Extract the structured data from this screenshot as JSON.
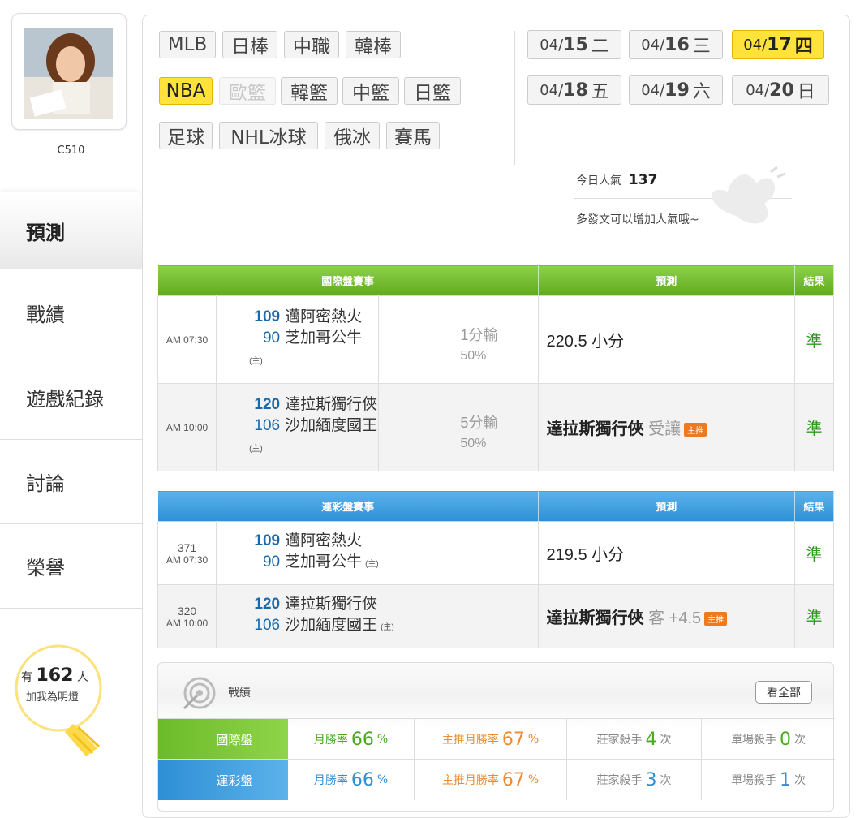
{
  "profile": {
    "name": "C510"
  },
  "nav": [
    {
      "label": "預測",
      "active": true
    },
    {
      "label": "戰績"
    },
    {
      "label": "遊戲紀錄"
    },
    {
      "label": "討論"
    },
    {
      "label": "榮譽"
    }
  ],
  "fans": {
    "prefix": "有",
    "count": "162",
    "suffix": "人",
    "line2": "加我為明燈"
  },
  "sports": {
    "row1": [
      "MLB",
      "日棒",
      "中職",
      "韓棒"
    ],
    "row2": [
      "NBA",
      "歐籃",
      "韓籃",
      "中籃",
      "日籃"
    ],
    "row3": [
      "足球",
      "NHL冰球",
      "俄冰",
      "賽馬"
    ],
    "selected": "NBA",
    "disabled": "歐籃"
  },
  "dates": [
    {
      "md": "04/",
      "d": "15",
      "w": "二"
    },
    {
      "md": "04/",
      "d": "16",
      "w": "三"
    },
    {
      "md": "04/",
      "d": "17",
      "w": "四",
      "selected": true
    },
    {
      "md": "04/",
      "d": "18",
      "w": "五"
    },
    {
      "md": "04/",
      "d": "19",
      "w": "六"
    },
    {
      "md": "04/",
      "d": "20",
      "w": "日"
    }
  ],
  "popularity": {
    "label": "今日人氣",
    "value": "137",
    "hint": "多發文可以增加人氣哦~"
  },
  "intl": {
    "headers": [
      "國際盤賽事",
      "預測",
      "結果"
    ],
    "rows": [
      {
        "time": "AM 07:30",
        "s1": "109",
        "t1": "邁阿密熱火",
        "s2": "90",
        "t2": "芝加哥公牛",
        "home": "(主)",
        "spread": "1分輸",
        "pct": "50%",
        "pred": "220.5 小分",
        "result": "準"
      },
      {
        "time": "AM 10:00",
        "s1": "120",
        "t1": "達拉斯獨行俠",
        "s2": "106",
        "t2": "沙加緬度國王",
        "home": "(主)",
        "spread": "5分輸",
        "pct": "50%",
        "pred": "達拉斯獨行俠",
        "pred_extra": "受讓",
        "badge": "主推",
        "result": "準"
      }
    ]
  },
  "lottery": {
    "headers": [
      "運彩盤賽事",
      "預測",
      "結果"
    ],
    "rows": [
      {
        "no": "371",
        "time": "AM 07:30",
        "s1": "109",
        "t1": "邁阿密熱火",
        "s2": "90",
        "t2": "芝加哥公牛",
        "home": "(主)",
        "pred": "219.5 小分",
        "result": "準"
      },
      {
        "no": "320",
        "time": "AM 10:00",
        "s1": "120",
        "t1": "達拉斯獨行俠",
        "s2": "106",
        "t2": "沙加緬度國王",
        "home": "(主)",
        "pred": "達拉斯獨行俠",
        "pred_extra": "客 +4.5",
        "badge": "主推",
        "result": "準"
      }
    ]
  },
  "record": {
    "title": "戰績",
    "view_all": "看全部",
    "rows": [
      {
        "label": "國際盤",
        "win_label": "月勝率",
        "win": "66",
        "main_label": "主推月勝率",
        "main": "67",
        "pct": "%",
        "dealer_label": "莊家殺手",
        "dealer": "4",
        "single_label": "單場殺手",
        "single": "0",
        "unit": "次"
      },
      {
        "label": "運彩盤",
        "win_label": "月勝率",
        "win": "66",
        "main_label": "主推月勝率",
        "main": "67",
        "pct": "%",
        "dealer_label": "莊家殺手",
        "dealer": "3",
        "single_label": "單場殺手",
        "single": "1",
        "unit": "次"
      }
    ]
  },
  "colors": {
    "green": "#6cbb2a",
    "blue": "#3a9be0",
    "yellow": "#ffe23a",
    "orange": "#ef8a2e"
  }
}
